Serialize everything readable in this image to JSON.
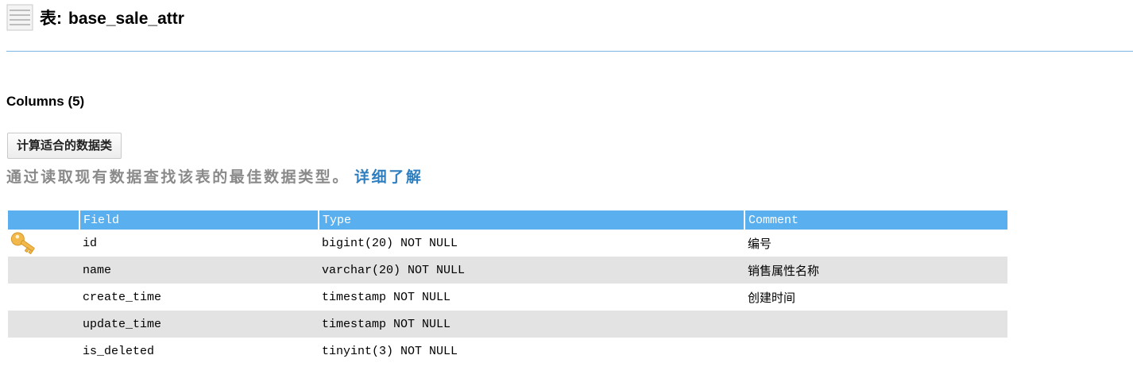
{
  "header": {
    "icon": "table-icon",
    "title_prefix": "表:",
    "table_name": "base_sale_attr"
  },
  "columns_section": {
    "title": "Columns (5)"
  },
  "calc_button": {
    "label": "计算适合的数据类"
  },
  "hint": {
    "text": "通过读取现有数据查找该表的最佳数据类型。",
    "link_label": "详细了解"
  },
  "table": {
    "headers": {
      "field": "Field",
      "type": "Type",
      "comment": "Comment"
    },
    "rows": [
      {
        "key": true,
        "key_icon": "key-icon",
        "field": "id",
        "type": "bigint(20) NOT NULL",
        "comment": "编号"
      },
      {
        "key": false,
        "field": "name",
        "type": "varchar(20) NOT NULL",
        "comment": "销售属性名称"
      },
      {
        "key": false,
        "field": "create_time",
        "type": "timestamp NOT NULL",
        "comment": "创建时间"
      },
      {
        "key": false,
        "field": "update_time",
        "type": "timestamp NOT NULL",
        "comment": ""
      },
      {
        "key": false,
        "field": "is_deleted",
        "type": "tinyint(3) NOT NULL",
        "comment": ""
      }
    ]
  },
  "colors": {
    "header_blue": "#5aafef",
    "rule_blue": "#79b6e6",
    "row_alt": "#e3e3e3",
    "link": "#2f7fc0",
    "key_gold": "#f2b84b"
  }
}
